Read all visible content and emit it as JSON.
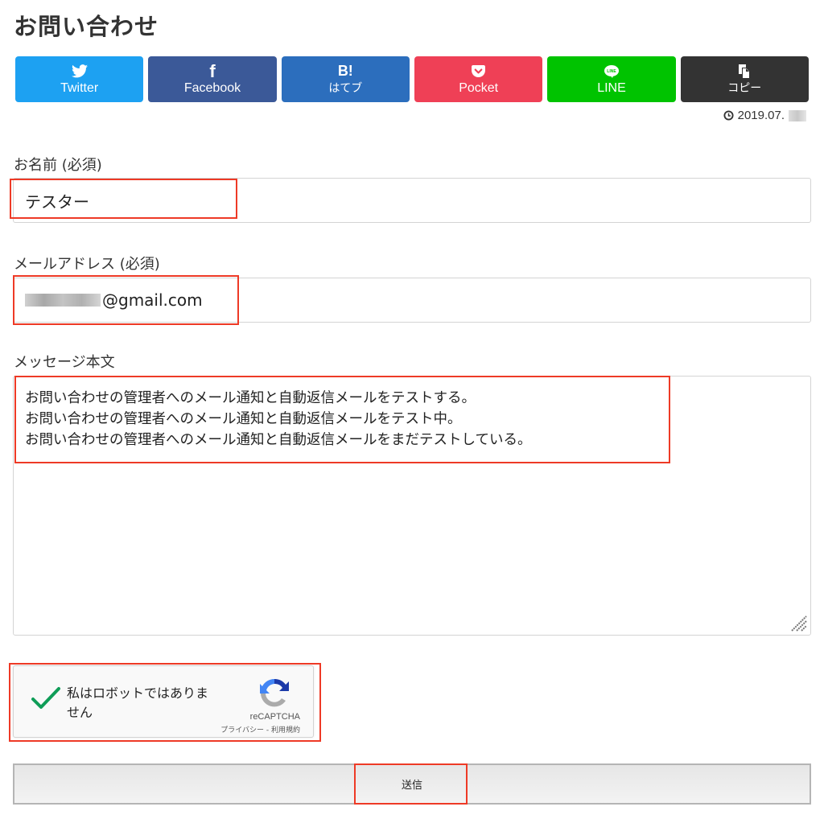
{
  "page": {
    "title": "お問い合わせ"
  },
  "share": {
    "buttons": [
      {
        "label": "Twitter",
        "icon": "twitter-bird-icon",
        "color": "#1da1f2"
      },
      {
        "label": "Facebook",
        "icon": "facebook-f-icon",
        "color": "#3b5998",
        "glyph": "f"
      },
      {
        "label": "はてブ",
        "icon": "hatena-bookmark-icon",
        "color": "#2c6ebd",
        "glyph": "B!"
      },
      {
        "label": "Pocket",
        "icon": "pocket-icon",
        "color": "#ef4056"
      },
      {
        "label": "LINE",
        "icon": "line-icon",
        "color": "#00c300"
      },
      {
        "label": "コピー",
        "icon": "copy-icon",
        "color": "#333333"
      }
    ]
  },
  "meta": {
    "date": "2019.07."
  },
  "form": {
    "name": {
      "label": "お名前 (必須)",
      "value": "テスター"
    },
    "email": {
      "label": "メールアドレス (必須)",
      "value_visible_suffix": "@gmail.com"
    },
    "message": {
      "label": "メッセージ本文",
      "lines": [
        "お問い合わせの管理者へのメール通知と自動返信メールをテストする。",
        "お問い合わせの管理者へのメール通知と自動返信メールをテスト中。",
        "お問い合わせの管理者へのメール通知と自動返信メールをまだテストしている。"
      ]
    },
    "captcha": {
      "text": "私はロボットではありません",
      "checked": true,
      "brand": "reCAPTCHA",
      "terms": "プライバシー - 利用規約"
    },
    "submit_label": "送信"
  },
  "colors": {
    "highlight": "#ee3a26",
    "check": "#0f9d58"
  }
}
